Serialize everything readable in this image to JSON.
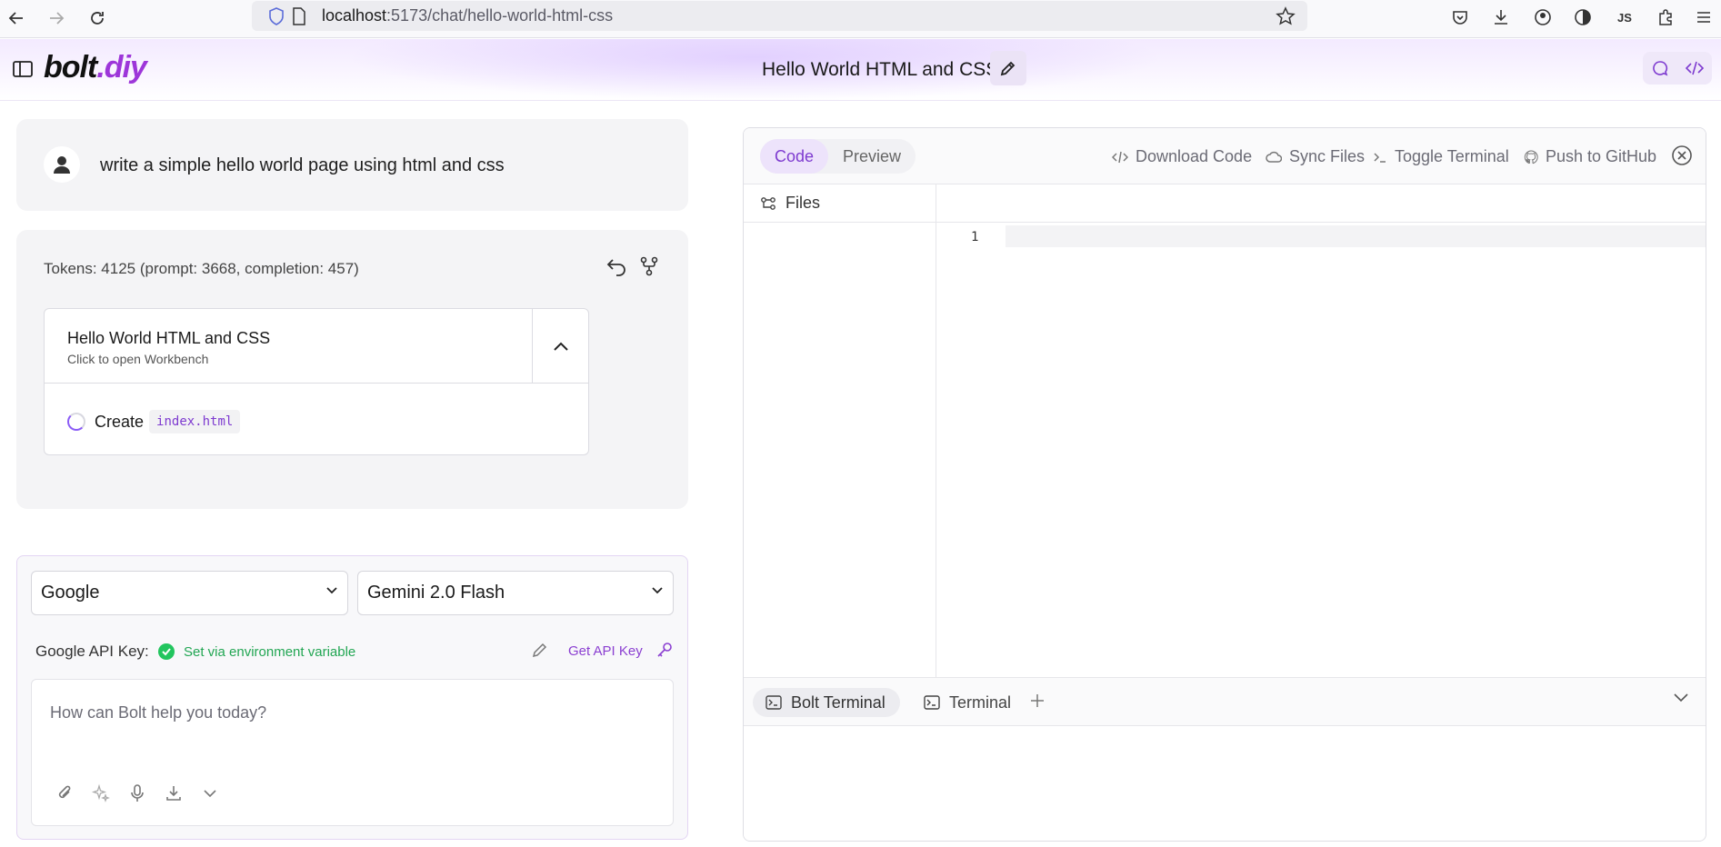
{
  "browser": {
    "url_host": "localhost",
    "url_rest": ":5173/chat/hello-world-html-css",
    "profile_initials": "JS"
  },
  "header": {
    "logo_main": "bolt",
    "logo_accent": ".diy",
    "chat_title": "Hello World HTML and CSS"
  },
  "chat": {
    "user_message": "write a simple hello world page using html and css",
    "tokens": "Tokens: 4125 (prompt: 3668, completion: 457)",
    "artifact": {
      "title": "Hello World HTML and CSS",
      "subtitle": "Click to open Workbench",
      "action_verb": "Create",
      "action_file": "index.html"
    }
  },
  "prompt": {
    "provider": "Google",
    "model": "Gemini 2.0 Flash",
    "api_key_label": "Google API Key:",
    "api_key_status": "Set via environment variable",
    "get_key_label": "Get API Key",
    "placeholder": "How can Bolt help you today?"
  },
  "workbench": {
    "tabs": [
      "Code",
      "Preview"
    ],
    "actions": {
      "download": "Download Code",
      "sync": "Sync Files",
      "terminal": "Toggle Terminal",
      "github": "Push to GitHub"
    },
    "files_label": "Files",
    "line_number": "1",
    "terminal_tabs": [
      "Bolt Terminal",
      "Terminal"
    ]
  },
  "colors": {
    "accent": "#8b3fd1",
    "success": "#22c55e"
  }
}
